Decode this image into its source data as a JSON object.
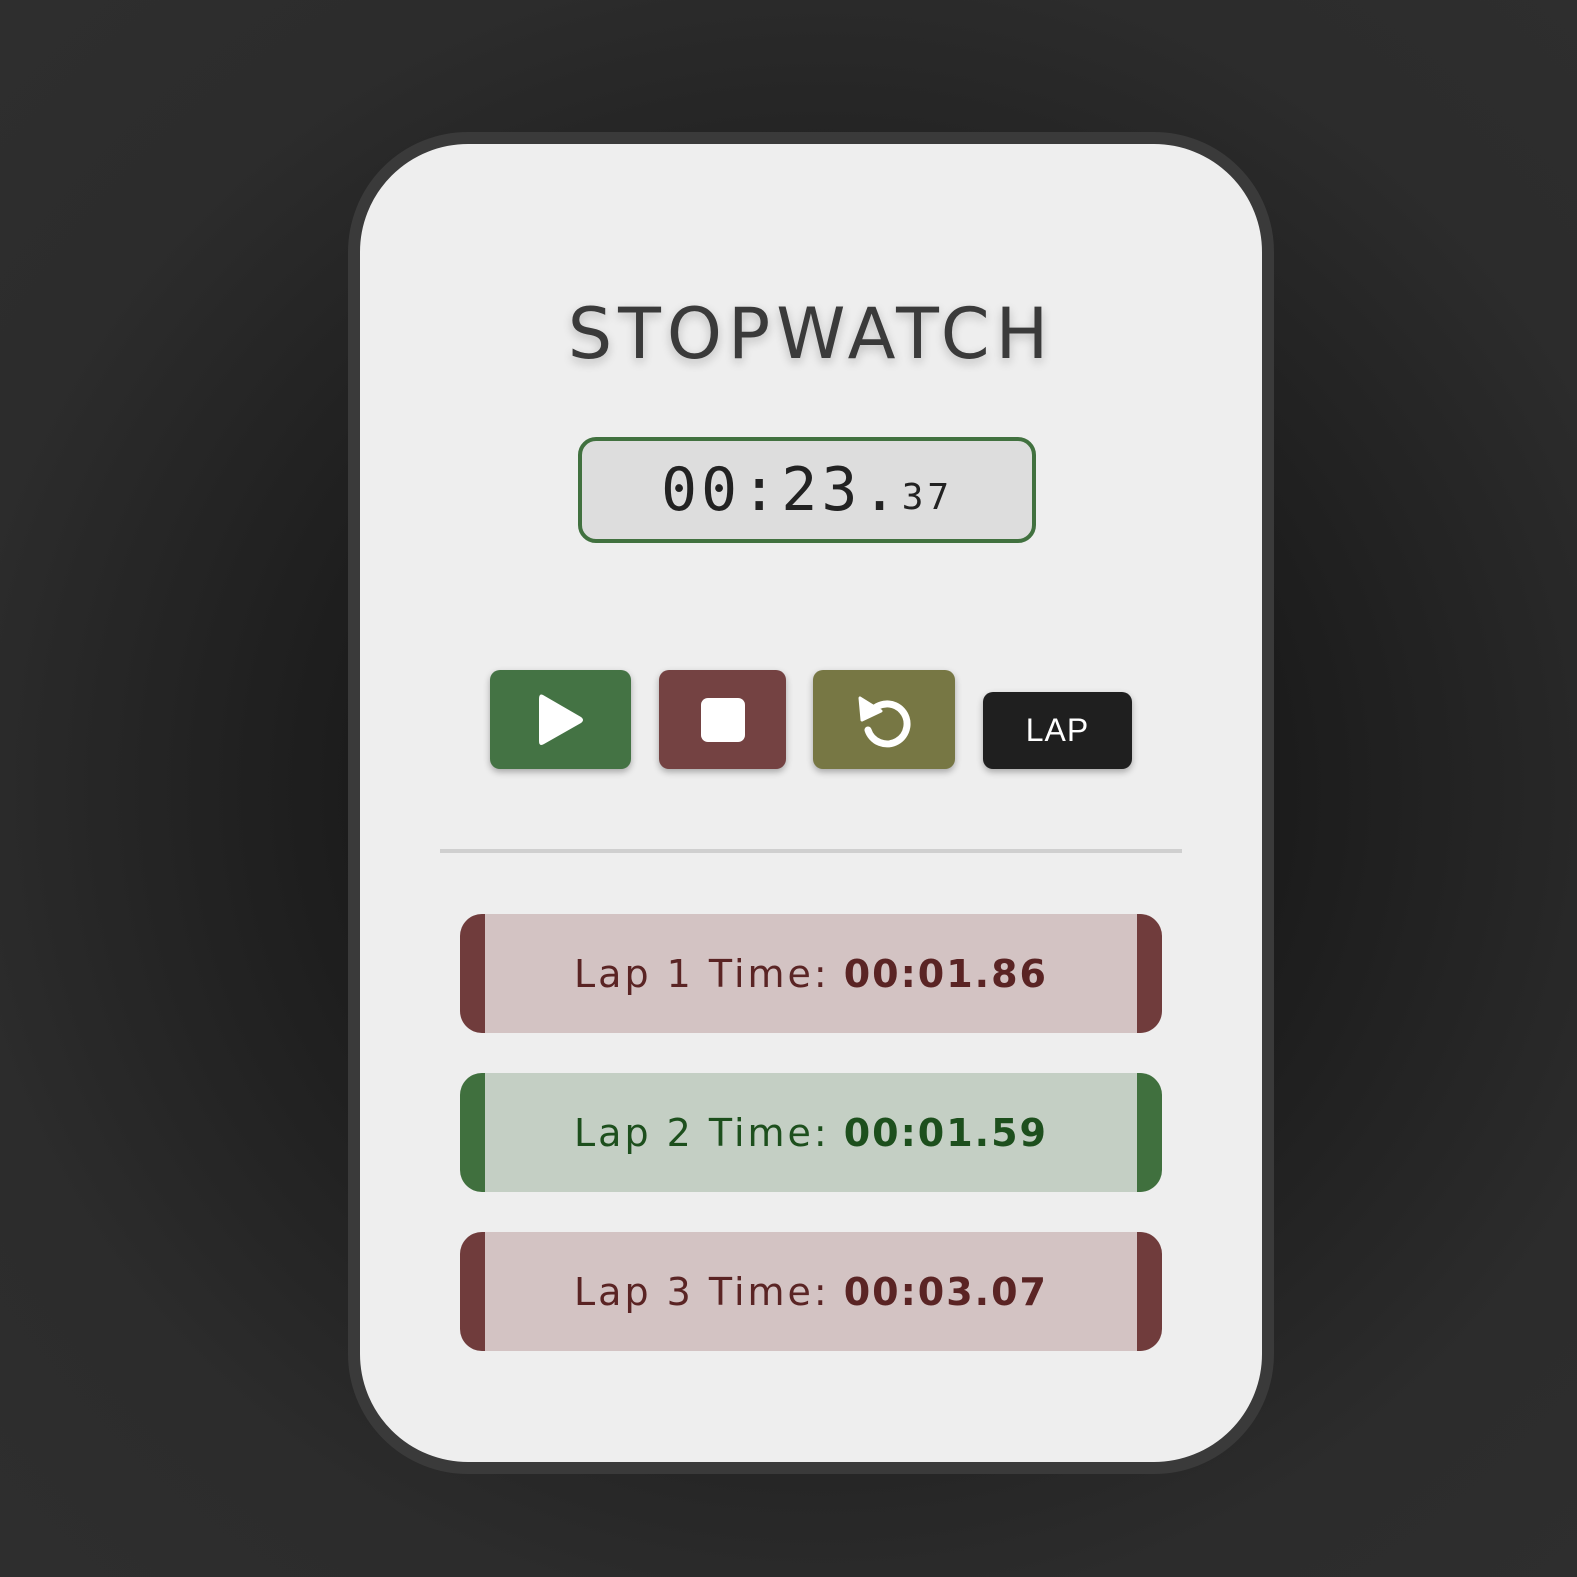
{
  "app": {
    "title": "STOPWATCH"
  },
  "display": {
    "main": "00:23.",
    "ms": "37"
  },
  "controls": {
    "start_icon": "play-icon",
    "stop_icon": "stop-icon",
    "reset_icon": "reset-icon",
    "lap_label": "LAP"
  },
  "colors": {
    "start": "#447344",
    "stop": "#744242",
    "reset": "#777744",
    "lap": "#1f1f1f",
    "display_border": "#41713f",
    "lap_slow_accent": "#703c3c",
    "lap_fast_accent": "#40703e"
  },
  "laps": [
    {
      "label": "Lap 1 Time:",
      "time": "00:01.86",
      "status": "slow"
    },
    {
      "label": "Lap 2 Time:",
      "time": "00:01.59",
      "status": "fast"
    },
    {
      "label": "Lap 3 Time:",
      "time": "00:03.07",
      "status": "slow"
    }
  ]
}
